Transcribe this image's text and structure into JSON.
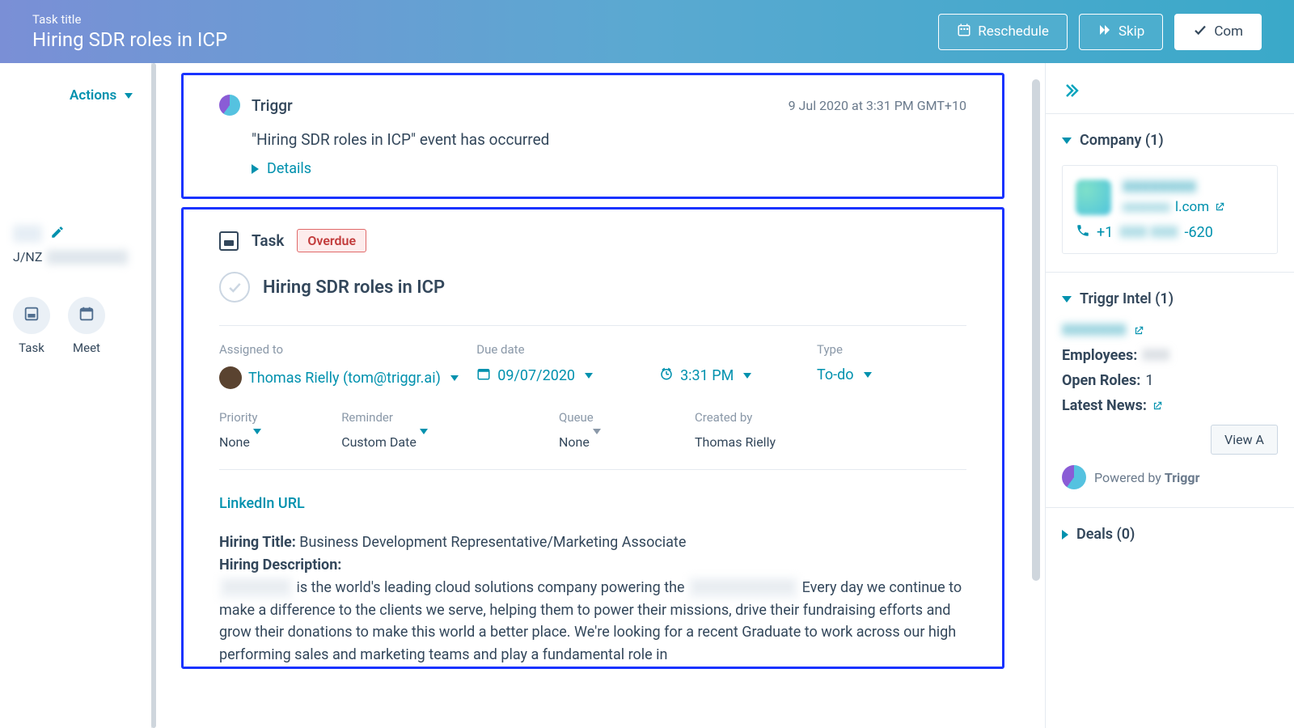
{
  "header": {
    "label": "Task title",
    "title": "Hiring SDR roles in ICP",
    "reschedule": "Reschedule",
    "skip": "Skip",
    "complete": "Com"
  },
  "left": {
    "actions": "Actions",
    "region_prefix": "J/NZ",
    "tool_task": "Task",
    "tool_meet": "Meet"
  },
  "event": {
    "source": "Triggr",
    "timestamp": "9 Jul 2020 at 3:31 PM GMT+10",
    "line": "\"Hiring SDR roles in ICP\" event has occurred",
    "details": "Details"
  },
  "task": {
    "section_label": "Task",
    "status_badge": "Overdue",
    "name": "Hiring SDR roles in ICP",
    "assigned_label": "Assigned to",
    "assigned_value": "Thomas Rielly (tom@triggr.ai)",
    "due_label": "Due date",
    "due_date": "09/07/2020",
    "due_time": "3:31 PM",
    "type_label": "Type",
    "type_value": "To-do",
    "priority_label": "Priority",
    "priority_value": "None",
    "reminder_label": "Reminder",
    "reminder_value": "Custom Date",
    "queue_label": "Queue",
    "queue_value": "None",
    "createdby_label": "Created by",
    "createdby_value": "Thomas Rielly",
    "linkedin": "LinkedIn URL",
    "hiring_title_label": "Hiring Title:",
    "hiring_title_value": "Business Development Representative/Marketing Associate",
    "hiring_desc_label": "Hiring Description:",
    "hiring_desc_a": " is the world's leading cloud solutions company powering the ",
    "hiring_desc_b": " Every day we continue to make a difference to the clients we serve, helping them to power their missions, drive their fundraising efforts and grow their donations to make this world a better place. We're looking for a recent Graduate to work across our high performing sales and marketing teams and play a fundamental role in"
  },
  "right": {
    "company_header": "Company (1)",
    "company_domain_suffix": "l.com",
    "phone_prefix": "+1",
    "phone_suffix": "-620",
    "triggr_header": "Triggr Intel (1)",
    "employees_label": "Employees:",
    "openroles_label": "Open Roles:",
    "openroles_value": "1",
    "latestnews_label": "Latest News:",
    "view_button": "View A",
    "powered_prefix": "Powered by ",
    "powered_brand": "Triggr",
    "deals_header": "Deals (0)"
  }
}
